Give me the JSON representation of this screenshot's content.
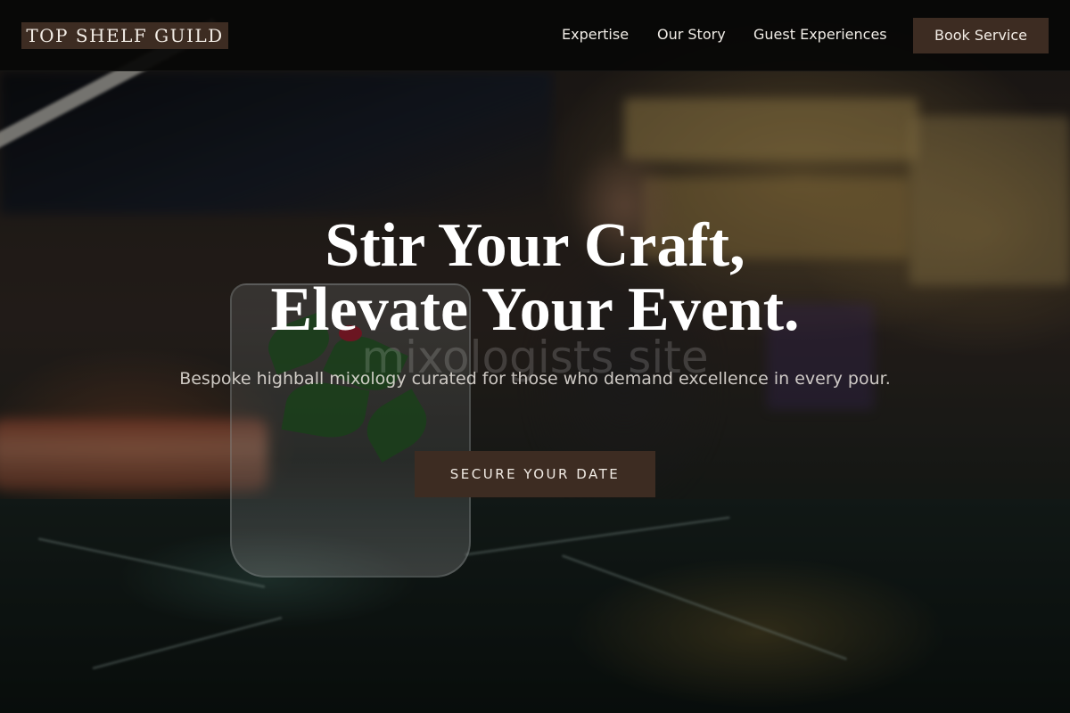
{
  "header": {
    "brand": "TOP SHELF GUILD",
    "nav": [
      {
        "label": "Expertise"
      },
      {
        "label": "Our Story"
      },
      {
        "label": "Guest Experiences"
      }
    ],
    "cta_label": "Book Service"
  },
  "hero": {
    "title_line1": "Stir Your Craft,",
    "title_line2": "Elevate Your Event.",
    "watermark": "mixologists site",
    "subtitle": "Bespoke highball mixology curated for those who demand excellence in every pour.",
    "cta_label": "SECURE YOUR DATE"
  },
  "colors": {
    "accent": "#3d2c22",
    "header_bg": "#080706",
    "text": "#ffffff"
  }
}
